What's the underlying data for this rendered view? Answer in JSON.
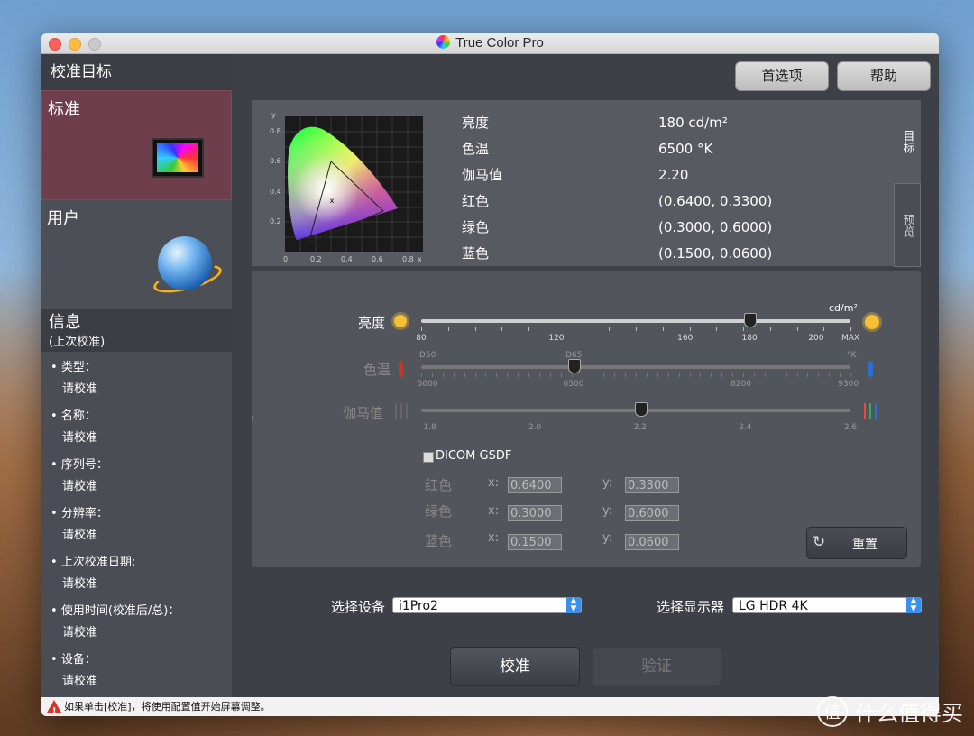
{
  "window": {
    "title": "True Color Pro"
  },
  "sidebar": {
    "header": "校准目标",
    "items": [
      {
        "label": "标准",
        "active": true
      },
      {
        "label": "用户",
        "active": false
      }
    ],
    "info": {
      "title": "信息",
      "subtitle": "(上次校准)",
      "rows": [
        {
          "label": "类型：",
          "value": "请校准"
        },
        {
          "label": "名称：",
          "value": "请校准"
        },
        {
          "label": "序列号：",
          "value": "请校准"
        },
        {
          "label": "分辨率：",
          "value": "请校准"
        },
        {
          "label": "上次校准日期:",
          "value": "请校准"
        },
        {
          "label": "使用时间(校准后/总)：",
          "value": "请校准"
        },
        {
          "label": "设备：",
          "value": "请校准"
        }
      ]
    }
  },
  "toolbar": {
    "preferences": "首选项",
    "help": "帮助"
  },
  "target": {
    "gamut_axis": {
      "y_label": "y",
      "x_label": "x",
      "y_ticks": [
        "0.8",
        "0.6",
        "0.4",
        "0.2"
      ],
      "x_ticks": [
        "0",
        "0.2",
        "0.4",
        "0.6",
        "0.8"
      ],
      "marker": "x"
    },
    "rows": [
      {
        "key": "亮度",
        "value": "180 cd/m²"
      },
      {
        "key": "色温",
        "value": "6500 °K"
      },
      {
        "key": "伽马值",
        "value": "2.20"
      },
      {
        "key": "红色",
        "value": "(0.6400, 0.3300)"
      },
      {
        "key": "绿色",
        "value": "(0.3000, 0.6000)"
      },
      {
        "key": "蓝色",
        "value": "(0.1500, 0.0600)"
      }
    ],
    "tabs": [
      "目标",
      "预览"
    ]
  },
  "controls": {
    "brightness": {
      "label": "亮度",
      "unit": "cd/m²",
      "value": 180,
      "ticks": [
        "80",
        "120",
        "160",
        "180",
        "200",
        "MAX"
      ]
    },
    "temperature": {
      "label": "色温",
      "unit": "°K",
      "value": 6500,
      "top_left": "D50",
      "top_mid": "D65",
      "ticks": [
        "5000",
        "6500",
        "8200",
        "9300"
      ]
    },
    "gamma": {
      "label": "伽马值",
      "value": 2.2,
      "ticks": [
        "1.8",
        "2.0",
        "2.2",
        "2.4",
        "2.6"
      ]
    },
    "dicom": {
      "label": "DICOM GSDF",
      "checked": false
    },
    "primaries": [
      {
        "label": "红色",
        "x": "0.6400",
        "y": "0.3300"
      },
      {
        "label": "绿色",
        "x": "0.3000",
        "y": "0.6000"
      },
      {
        "label": "蓝色",
        "x": "0.1500",
        "y": "0.0600"
      }
    ],
    "x_label": "x:",
    "y_label": "y:",
    "reset": "重置"
  },
  "device": {
    "label": "选择设备",
    "value": "i1Pro2"
  },
  "display": {
    "label": "选择显示器",
    "value": "LG HDR 4K"
  },
  "actions": {
    "calibrate": "校准",
    "verify": "验证"
  },
  "status": {
    "message": "如果单击[校准]，将使用配置值开始屏幕调整。"
  },
  "watermark": {
    "text": "什么值得买",
    "glyph": "值"
  },
  "colors": {
    "active_item": "#6e3e4d",
    "accent": "#3d8ee8",
    "warning": "#d8342c"
  }
}
